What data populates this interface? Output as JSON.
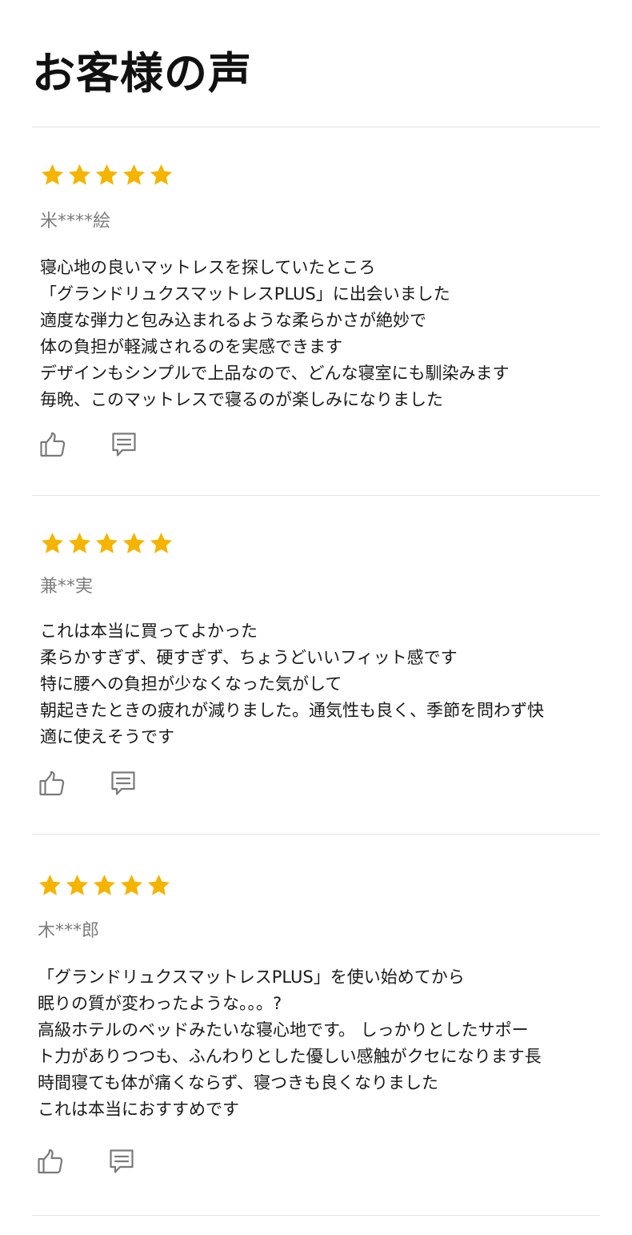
{
  "header": {
    "title": "お客様の声"
  },
  "colors": {
    "star": "#f5b400",
    "icon": "#7a7a7a",
    "divider": "#e5e5e5"
  },
  "icons": {
    "like": "thumbs-up-icon",
    "comment": "comment-icon"
  },
  "reviews": [
    {
      "rating": 5,
      "reviewer": "米****絵",
      "lines": [
        "寝心地の良いマットレスを探していたところ",
        "「グランドリュクスマットレスPLUS」に出会いました",
        "適度な弾力と包み込まれるような柔らかさが絶妙で",
        "体の負担が軽減されるのを実感できます",
        "デザインもシンプルで上品なので、どんな寝室にも馴染みます",
        "毎晩、このマットレスで寝るのが楽しみになりました"
      ]
    },
    {
      "rating": 5,
      "reviewer": "兼**実",
      "lines": [
        "これは本当に買ってよかった",
        "柔らかすぎず、硬すぎず、ちょうどいいフィット感です",
        "特に腰への負担が少なくなった気がして",
        "朝起きたときの疲れが減りました。通気性も良く、季節を問わず快",
        "適に使えそうです"
      ]
    },
    {
      "rating": 5,
      "reviewer": "木***郎",
      "lines": [
        "「グランドリュクスマットレスPLUS」を使い始めてから",
        "眠りの質が変わったような。。。?",
        "高級ホテルのベッドみたいな寝心地です。 しっかりとしたサポー",
        "ト力がありつつも、ふんわりとした優しい感触がクセになります長",
        "時間寝ても体が痛くならず、寝つきも良くなりました",
        "これは本当におすすめです"
      ]
    }
  ]
}
